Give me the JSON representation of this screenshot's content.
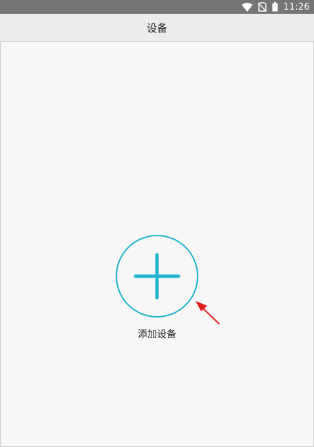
{
  "status_bar": {
    "time": "11:26",
    "icons": [
      "wifi-icon",
      "no-sim-icon",
      "battery-icon"
    ],
    "background": "#757575"
  },
  "app_bar": {
    "title": "设备"
  },
  "main": {
    "add_device": {
      "label": "添加设备",
      "icon": "plus-icon",
      "accent": "#1fb3cf"
    }
  },
  "annotation": {
    "icon": "red-arrow-icon",
    "color": "#e0201c"
  }
}
